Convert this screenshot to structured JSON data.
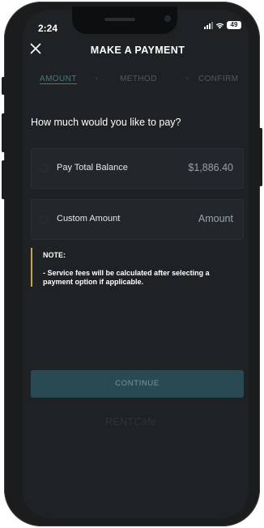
{
  "status_bar": {
    "time": "2:24",
    "battery": "49"
  },
  "header": {
    "title": "MAKE A PAYMENT"
  },
  "steps": [
    {
      "label": "AMOUNT",
      "active": true
    },
    {
      "label": "METHOD",
      "active": false
    },
    {
      "label": "CONFIRM",
      "active": false
    }
  ],
  "step_separator": "›",
  "question": "How much would you like to pay?",
  "options": [
    {
      "label": "Pay Total Balance",
      "value": "$1,886.40"
    },
    {
      "label": "Custom Amount",
      "value": "Amount"
    }
  ],
  "note": {
    "title": "NOTE:",
    "text": " - Service fees will be calculated after selecting a payment option if applicable."
  },
  "continue_label": "CONTINUE",
  "brand": {
    "part1": "RENT",
    "part2": "Café"
  },
  "colors": {
    "accent": "#3f7b86",
    "note_bar": "#c9a44a",
    "button_bg": "#2a4a53",
    "screen_bg": "#1e2225"
  },
  "icons": {
    "close": "close-icon",
    "signal": "signal-icon",
    "wifi": "wifi-icon",
    "battery": "battery-icon"
  }
}
